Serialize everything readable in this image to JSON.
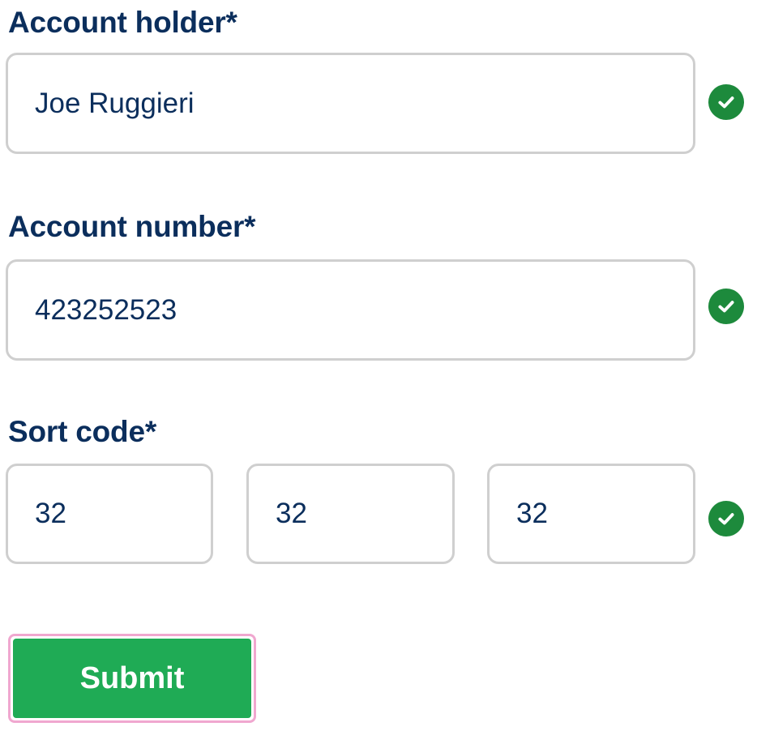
{
  "account_holder": {
    "label": "Account holder*",
    "value": "Joe Ruggieri",
    "valid": true
  },
  "account_number": {
    "label": "Account number*",
    "value": "423252523",
    "valid": true
  },
  "sort_code": {
    "label": "Sort code*",
    "parts": [
      "32",
      "32",
      "32"
    ],
    "valid": true
  },
  "submit": {
    "label": "Submit"
  },
  "colors": {
    "label_text": "#0b2e5c",
    "field_border": "#cfcfcf",
    "check_bg": "#1d8a3c",
    "submit_bg": "#1fab55",
    "focus_ring": "#f0a7cf"
  },
  "icons": {
    "valid": "check-circle-icon"
  }
}
